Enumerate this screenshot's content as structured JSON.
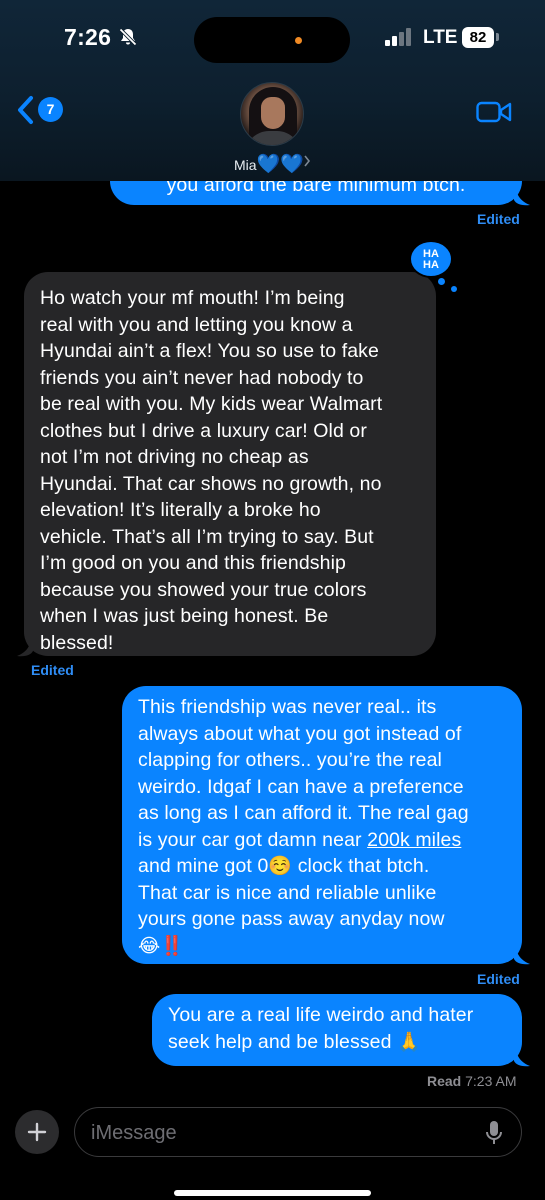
{
  "status_bar": {
    "time": "7:26",
    "network": "LTE",
    "battery": "82"
  },
  "header": {
    "back_count": "7",
    "contact_name": "Mia",
    "contact_hearts": "💙💙"
  },
  "messages": [
    {
      "direction": "outgoing",
      "text": "you afford the bare minimum btch.",
      "meta": "Edited"
    },
    {
      "direction": "incoming",
      "reaction": "HA HA",
      "lines": [
        "Ho watch your mf mouth! I’m being",
        "real with you and letting you know a",
        "Hyundai ain’t a flex! You so use to fake",
        "friends you ain’t never had nobody to",
        "be real with you. My kids wear Walmart",
        "clothes but I drive a luxury car! Old or",
        "not I’m not driving no cheap as",
        "Hyundai. That car shows no growth, no",
        "elevation! It’s literally a broke ho",
        "vehicle. That’s all I’m trying to say. But",
        "I’m good on you and this friendship",
        "because you showed your true colors",
        "when I was just being honest. Be",
        "blessed!"
      ],
      "meta": "Edited"
    },
    {
      "direction": "outgoing",
      "lines": [
        "This friendship was never real.. its",
        "always about what you got instead of",
        "clapping for others.. you’re the real",
        "weirdo. Idgaf I can have a preference",
        "as long as I can afford it. The real gag",
        "is your car got damn near ",
        "200k miles",
        "and mine got 0",
        "☺️",
        " clock that btch.",
        "That car is nice and reliable unlike",
        "yours gone pass away anyday now",
        "😂‼️"
      ],
      "meta": "Edited"
    },
    {
      "direction": "outgoing",
      "lines": [
        "You are a real life weirdo and hater",
        "seek help and be blessed ",
        "🙏"
      ],
      "meta_label": "Read",
      "meta_time": "7:23 AM"
    }
  ],
  "input": {
    "placeholder": "iMessage"
  },
  "colors": {
    "outgoing": "#0a84ff",
    "incoming": "#262628",
    "accent": "#0a84ff"
  },
  "icons": [
    "bell-slash-icon",
    "signal-icon",
    "back-chevron-icon",
    "video-camera-icon",
    "plus-icon",
    "microphone-icon"
  ]
}
